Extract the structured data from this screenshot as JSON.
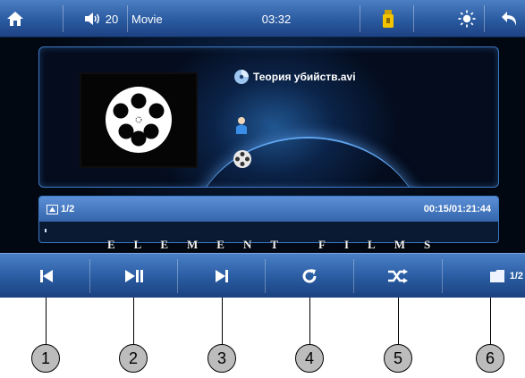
{
  "topbar": {
    "home_icon": "home-icon",
    "volume_icon": "volume-icon",
    "volume_level": "20",
    "mode": "Movie",
    "time": "03:32",
    "usb_icon": "usb-drive-icon",
    "brightness_icon": "brightness-icon",
    "back_icon": "back-arrow-icon"
  },
  "player": {
    "file_name": "Теория убийств.avi",
    "file_icon": "disc-icon",
    "person_icon": "person-icon",
    "reel_icon": "film-reel-icon"
  },
  "progress": {
    "track_index": "1/2",
    "time_display": "00:15/01:21:44",
    "played_fraction": 0.003
  },
  "overlay": {
    "watermark_text": "ELEMENT FILMS"
  },
  "controls": [
    {
      "name": "previous-button",
      "icon": "skip-previous-icon",
      "callout": "1"
    },
    {
      "name": "play-pause-button",
      "icon": "play-pause-icon",
      "callout": "2"
    },
    {
      "name": "next-button",
      "icon": "skip-next-icon",
      "callout": "3"
    },
    {
      "name": "repeat-button",
      "icon": "repeat-icon",
      "callout": "4"
    },
    {
      "name": "shuffle-button",
      "icon": "shuffle-icon",
      "callout": "5"
    },
    {
      "name": "page-button",
      "icon": "folder-icon",
      "callout": "6",
      "label": "1/2"
    }
  ],
  "colors": {
    "bar_blue": "#2b5ea4",
    "screen_dark": "#071833",
    "callout_fill": "#bcbcbc"
  }
}
